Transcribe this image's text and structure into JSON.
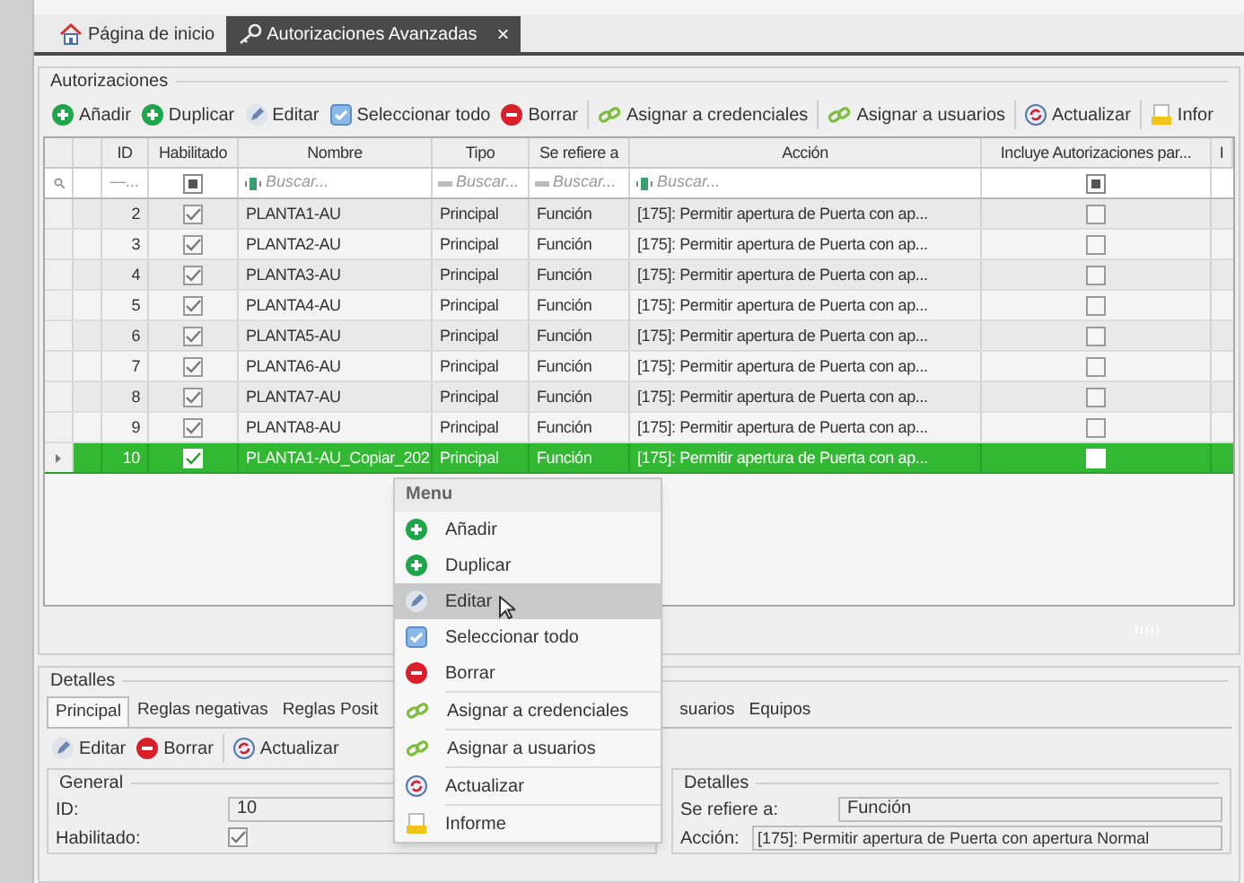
{
  "doc_tabs": [
    {
      "label": "Página de inicio",
      "selected": false,
      "closable": false
    },
    {
      "label": "Autorizaciones Avanzadas",
      "selected": true,
      "closable": true,
      "close": "×"
    }
  ],
  "authorizations": {
    "title": "Autorizaciones",
    "toolbar": [
      {
        "label": "Añadir",
        "kind": "add"
      },
      {
        "label": "Duplicar",
        "kind": "add"
      },
      {
        "label": "Editar",
        "kind": "edit"
      },
      {
        "label": "Seleccionar todo",
        "kind": "select"
      },
      {
        "label": "Borrar",
        "kind": "delete"
      },
      {
        "label": "Asignar a credenciales",
        "kind": "link"
      },
      {
        "label": "Asignar a usuarios",
        "kind": "link"
      },
      {
        "label": "Actualizar",
        "kind": "refresh"
      },
      {
        "label": "Infor",
        "kind": "report"
      }
    ],
    "columns": [
      "ID",
      "Habilitado",
      "Nombre",
      "Tipo",
      "Se refiere a",
      "Acción",
      "Incluye Autorizaciones par...",
      "I"
    ],
    "filters": {
      "id": "—...",
      "enabled_checked": true,
      "name": "Buscar...",
      "type": "Buscar...",
      "refers": "Buscar...",
      "action": "Buscar...",
      "includes_checked": true
    },
    "rows": [
      {
        "id": "2",
        "enabled": true,
        "name": "PLANTA1-AU",
        "type": "Principal",
        "refers": "Función",
        "action": "[175]: Permitir apertura de Puerta con ap...",
        "includes": false,
        "selected": false
      },
      {
        "id": "3",
        "enabled": true,
        "name": "PLANTA2-AU",
        "type": "Principal",
        "refers": "Función",
        "action": "[175]: Permitir apertura de Puerta con ap...",
        "includes": false,
        "selected": false
      },
      {
        "id": "4",
        "enabled": true,
        "name": "PLANTA3-AU",
        "type": "Principal",
        "refers": "Función",
        "action": "[175]: Permitir apertura de Puerta con ap...",
        "includes": false,
        "selected": false
      },
      {
        "id": "5",
        "enabled": true,
        "name": "PLANTA4-AU",
        "type": "Principal",
        "refers": "Función",
        "action": "[175]: Permitir apertura de Puerta con ap...",
        "includes": false,
        "selected": false
      },
      {
        "id": "6",
        "enabled": true,
        "name": "PLANTA5-AU",
        "type": "Principal",
        "refers": "Función",
        "action": "[175]: Permitir apertura de Puerta con ap...",
        "includes": false,
        "selected": false
      },
      {
        "id": "7",
        "enabled": true,
        "name": "PLANTA6-AU",
        "type": "Principal",
        "refers": "Función",
        "action": "[175]: Permitir apertura de Puerta con ap...",
        "includes": false,
        "selected": false
      },
      {
        "id": "8",
        "enabled": true,
        "name": "PLANTA7-AU",
        "type": "Principal",
        "refers": "Función",
        "action": "[175]: Permitir apertura de Puerta con ap...",
        "includes": false,
        "selected": false
      },
      {
        "id": "9",
        "enabled": true,
        "name": "PLANTA8-AU",
        "type": "Principal",
        "refers": "Función",
        "action": "[175]: Permitir apertura de Puerta con ap...",
        "includes": false,
        "selected": false
      },
      {
        "id": "10",
        "enabled": true,
        "name": "PLANTA1-AU_Copiar_202",
        "type": "Principal",
        "refers": "Función",
        "action": "[175]: Permitir apertura de Puerta con ap...",
        "includes": false,
        "selected": true
      }
    ]
  },
  "details": {
    "title": "Detalles",
    "tabs": [
      {
        "label": "Principal",
        "selected": true
      },
      {
        "label": "Reglas negativas",
        "selected": false
      },
      {
        "label": "Reglas Posit",
        "selected": false
      },
      {
        "label": "suarios",
        "selected": false
      },
      {
        "label": "Equipos",
        "selected": false
      }
    ],
    "toolbar": [
      {
        "label": "Editar",
        "kind": "edit"
      },
      {
        "label": "Borrar",
        "kind": "delete"
      },
      {
        "label": "Actualizar",
        "kind": "refresh"
      }
    ],
    "general": {
      "title": "General",
      "id_label": "ID:",
      "id_value": "10",
      "enabled_label": "Habilitado:",
      "enabled": true
    },
    "info": {
      "title": "Detalles",
      "refers_label": "Se refiere a:",
      "refers_value": "Función",
      "action_label": "Acción:",
      "action_value": "[175]: Permitir apertura de Puerta con apertura Normal"
    }
  },
  "context_menu": {
    "title": "Menu",
    "items": [
      {
        "label": "Añadir",
        "kind": "add",
        "selected": false,
        "separator": false
      },
      {
        "label": "Duplicar",
        "kind": "add",
        "selected": false,
        "separator": false
      },
      {
        "label": "Editar",
        "kind": "edit",
        "selected": true,
        "separator": false
      },
      {
        "label": "Seleccionar todo",
        "kind": "select",
        "selected": false,
        "separator": false
      },
      {
        "label": "Borrar",
        "kind": "delete",
        "selected": false,
        "separator": true
      },
      {
        "label": "Asignar a credenciales",
        "kind": "link",
        "selected": false,
        "separator": true
      },
      {
        "label": "Asignar a usuarios",
        "kind": "link",
        "selected": false,
        "separator": true
      },
      {
        "label": "Actualizar",
        "kind": "refresh",
        "selected": false,
        "separator": true
      },
      {
        "label": "Informe",
        "kind": "report",
        "selected": false,
        "separator": false
      }
    ]
  }
}
